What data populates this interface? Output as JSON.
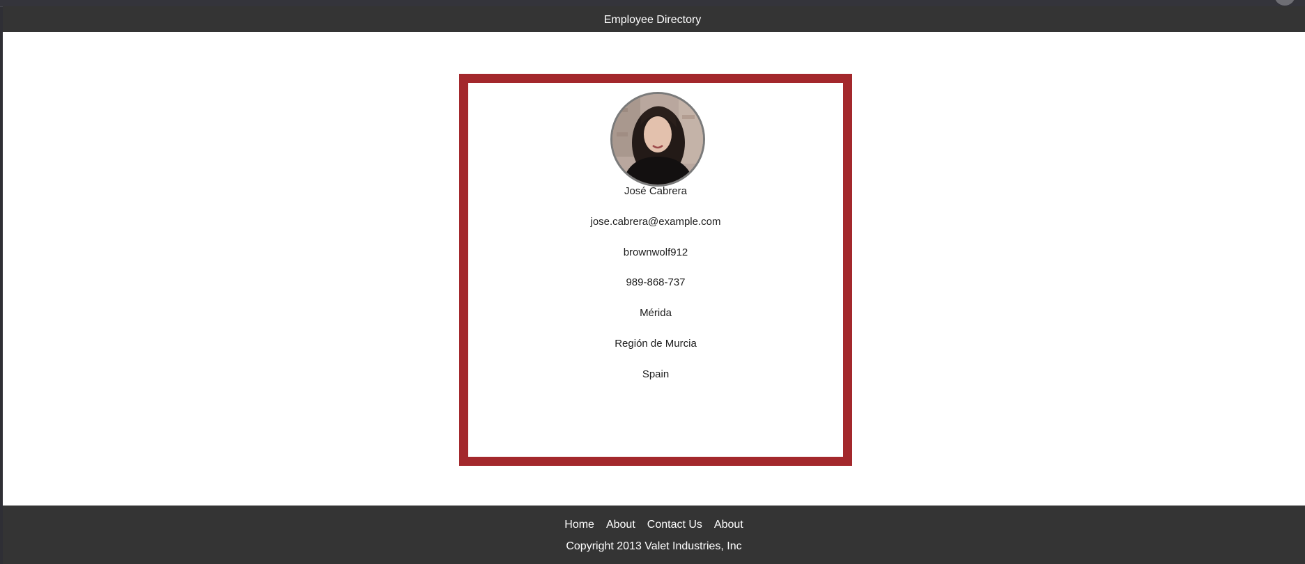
{
  "header": {
    "title": "Employee Directory"
  },
  "employee": {
    "avatar_icon": "portrait-photo",
    "name": "José Cabrera",
    "email": "jose.cabrera@example.com",
    "username": "brownwolf912",
    "phone": "989-868-737",
    "city": "Mérida",
    "region": "Región de Murcia",
    "country": "Spain"
  },
  "footer": {
    "nav": [
      "Home",
      "About",
      "Contact Us",
      "About"
    ],
    "copyright": "Copyright 2013 Valet Industries, Inc"
  },
  "colors": {
    "card_border": "#a3282c",
    "bar_background": "#343434",
    "page_background": "#ffffff"
  }
}
